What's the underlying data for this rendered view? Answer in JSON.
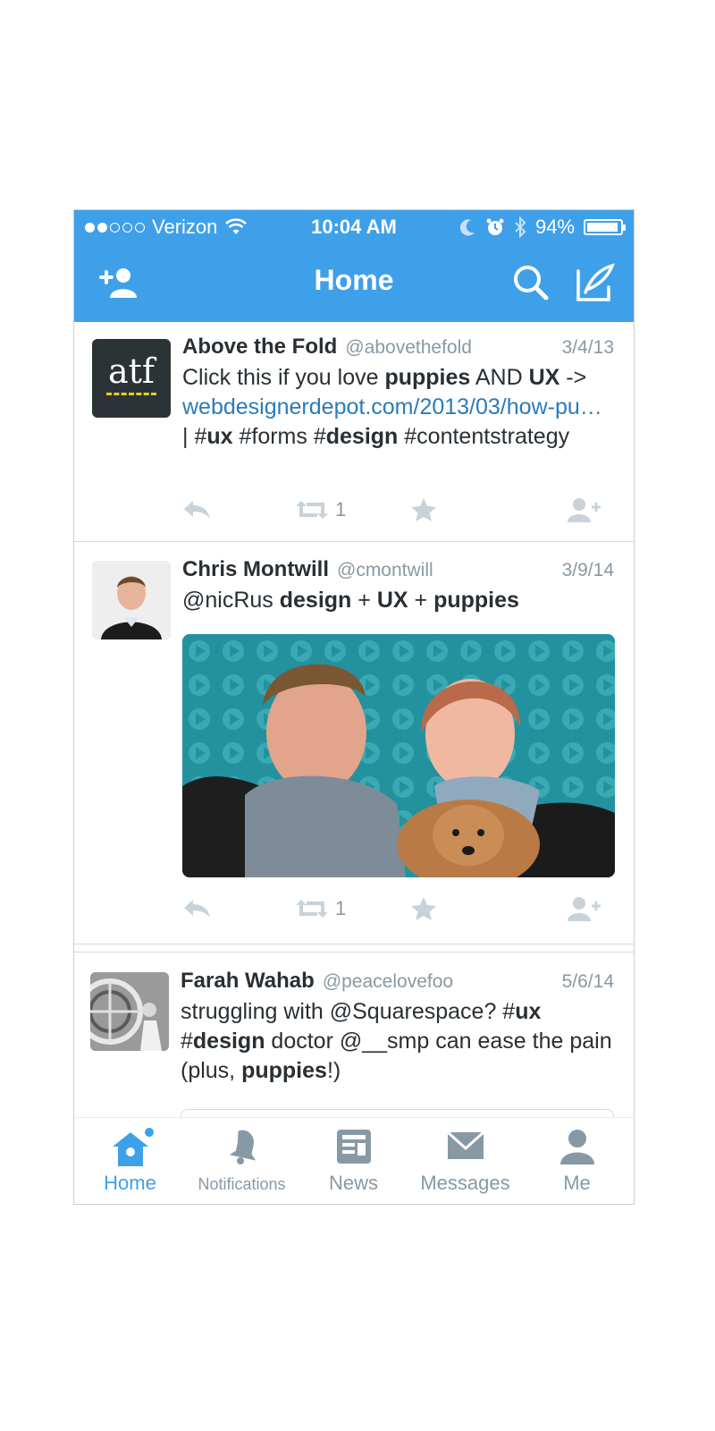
{
  "status_bar": {
    "carrier": "Verizon",
    "time": "10:04 AM",
    "battery": "94%",
    "battery_level": 0.94
  },
  "nav": {
    "title": "Home"
  },
  "tweets": [
    {
      "name": "Above the Fold",
      "handle": "@abovethefold",
      "date": "3/4/13",
      "avatar_text": "atf",
      "text": {
        "t1": "Click this if you love ",
        "b1": "puppies",
        "t2": " AND ",
        "b2": "UX",
        "t3": " ->",
        "link": "webdesignerdepot.com/2013/03/how-pu…",
        "t4": " | #",
        "b3": "ux",
        "t5": " #forms #",
        "b4": "design",
        "t6": " #contentstrategy"
      },
      "retweet_count": "1"
    },
    {
      "name": "Chris Montwill",
      "handle": "@cmontwill",
      "date": "3/9/14",
      "text": {
        "t1": "@nicRus ",
        "b1": "design",
        "t2": " + ",
        "b2": "UX",
        "t3": " + ",
        "b3": "puppies"
      },
      "retweet_count": "1"
    },
    {
      "name": "Farah Wahab",
      "handle": "@peacelovefoo",
      "date": "5/6/14",
      "text": {
        "t1": "struggling with @Squarespace? #",
        "b1": "ux",
        "t2": " #",
        "b2": "design",
        "t3": " doctor @__smp can ease the pain (plus, ",
        "b3": "puppies",
        "t4": "!)"
      }
    }
  ],
  "tabs": [
    {
      "label": "Home"
    },
    {
      "label": "Notifications"
    },
    {
      "label": "News"
    },
    {
      "label": "Messages"
    },
    {
      "label": "Me"
    }
  ],
  "colors": {
    "brand": "#3fa0ea",
    "link": "#2b7bb9",
    "muted": "#8899a6"
  }
}
